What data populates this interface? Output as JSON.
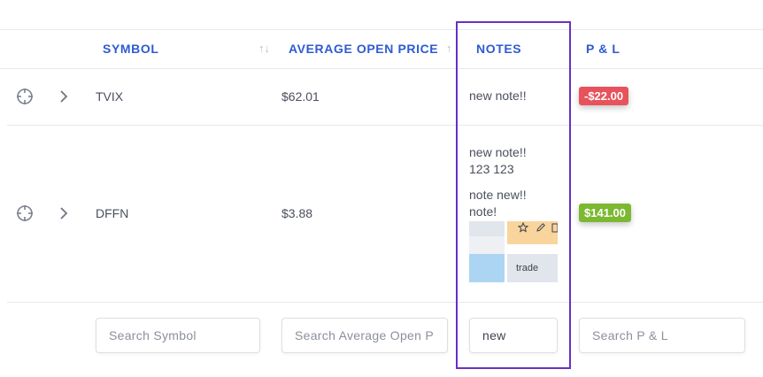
{
  "table": {
    "headers": {
      "symbol": "SYMBOL",
      "avg_open_price": "AVERAGE OPEN PRICE",
      "notes": "NOTES",
      "pnl": "P & L"
    },
    "rows": [
      {
        "symbol": "TVIX",
        "avg_open_price": "$62.01",
        "notes": [
          "new note!!"
        ],
        "pnl": "-$22.00",
        "pnl_color": "#e8525b"
      },
      {
        "symbol": "DFFN",
        "avg_open_price": "$3.88",
        "notes": [
          "new note!!",
          "123 123",
          "note new!!",
          "note!"
        ],
        "pnl": "$141.00",
        "pnl_color": "#7cb832",
        "note_image_label": "trade"
      }
    ],
    "filters": {
      "symbol_placeholder": "Search Symbol",
      "avg_open_price_placeholder": "Search Average Open P",
      "notes_value": "new",
      "pnl_placeholder": "Search P & L"
    }
  },
  "colors": {
    "header_text": "#2f5bd1",
    "highlight_border": "#6a2fc4"
  },
  "icons": [
    "crosshair-icon",
    "chevron-right-icon",
    "sort-icon",
    "star-icon",
    "pencil-icon",
    "trash-icon"
  ]
}
